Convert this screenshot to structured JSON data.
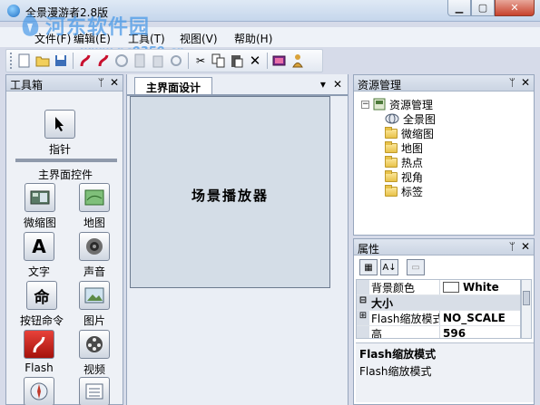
{
  "window": {
    "title": "全景漫游者2.8版"
  },
  "watermark": {
    "text": "河东软件园",
    "url": "www.pc0359.cn"
  },
  "menu": [
    "文件(F)",
    "编辑(E)",
    "工具(T)",
    "视图(V)",
    "帮助(H)"
  ],
  "toolbox": {
    "title": "工具箱",
    "pointer_label": "指针",
    "group_label": "主界面控件",
    "tools": [
      {
        "label": "微缩图",
        "icon": "thumbnail-icon"
      },
      {
        "label": "地图",
        "icon": "map-icon"
      },
      {
        "label": "文字",
        "icon": "text-icon",
        "glyph": "A"
      },
      {
        "label": "声音",
        "icon": "speaker-icon"
      },
      {
        "label": "按钮命令",
        "icon": "command-icon",
        "glyph": "命"
      },
      {
        "label": "图片",
        "icon": "picture-icon"
      },
      {
        "label": "Flash",
        "icon": "flash-icon"
      },
      {
        "label": "视频",
        "icon": "video-icon"
      }
    ]
  },
  "document": {
    "tab": "主界面设计",
    "canvas_text": "场景播放器"
  },
  "resources": {
    "title": "资源管理",
    "root": "资源管理",
    "items": [
      "全景图",
      "微缩图",
      "地图",
      "热点",
      "视角",
      "标签"
    ]
  },
  "properties": {
    "title": "属性",
    "rows": [
      {
        "name": "背景颜色",
        "value": "White",
        "swatch": "#ffffff"
      },
      {
        "category": "大小",
        "expander": "⊟"
      },
      {
        "name": "Flash缩放模式",
        "value": "NO_SCALE",
        "expander": "⊞"
      },
      {
        "name": "高",
        "value": "596"
      }
    ],
    "description_title": "Flash缩放模式",
    "description_text": "Flash缩放模式"
  }
}
